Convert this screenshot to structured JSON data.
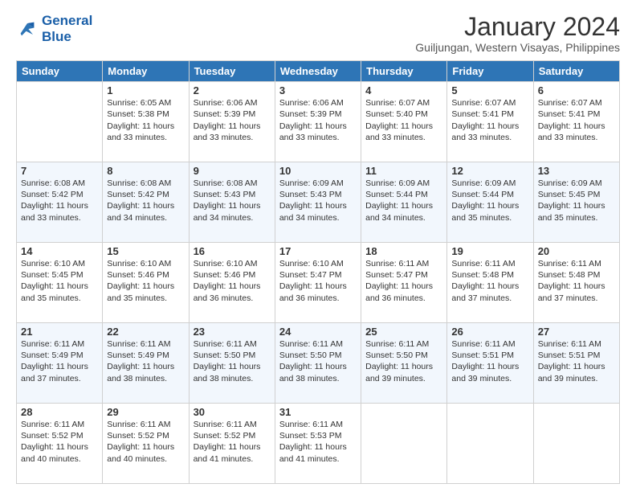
{
  "logo": {
    "line1": "General",
    "line2": "Blue"
  },
  "title": "January 2024",
  "location": "Guiljungan, Western Visayas, Philippines",
  "days": [
    "Sunday",
    "Monday",
    "Tuesday",
    "Wednesday",
    "Thursday",
    "Friday",
    "Saturday"
  ],
  "weeks": [
    [
      {
        "num": "",
        "empty": true
      },
      {
        "num": "1",
        "sunrise": "Sunrise: 6:05 AM",
        "sunset": "Sunset: 5:38 PM",
        "daylight": "Daylight: 11 hours and 33 minutes."
      },
      {
        "num": "2",
        "sunrise": "Sunrise: 6:06 AM",
        "sunset": "Sunset: 5:39 PM",
        "daylight": "Daylight: 11 hours and 33 minutes."
      },
      {
        "num": "3",
        "sunrise": "Sunrise: 6:06 AM",
        "sunset": "Sunset: 5:39 PM",
        "daylight": "Daylight: 11 hours and 33 minutes."
      },
      {
        "num": "4",
        "sunrise": "Sunrise: 6:07 AM",
        "sunset": "Sunset: 5:40 PM",
        "daylight": "Daylight: 11 hours and 33 minutes."
      },
      {
        "num": "5",
        "sunrise": "Sunrise: 6:07 AM",
        "sunset": "Sunset: 5:41 PM",
        "daylight": "Daylight: 11 hours and 33 minutes."
      },
      {
        "num": "6",
        "sunrise": "Sunrise: 6:07 AM",
        "sunset": "Sunset: 5:41 PM",
        "daylight": "Daylight: 11 hours and 33 minutes."
      }
    ],
    [
      {
        "num": "7",
        "sunrise": "Sunrise: 6:08 AM",
        "sunset": "Sunset: 5:42 PM",
        "daylight": "Daylight: 11 hours and 33 minutes."
      },
      {
        "num": "8",
        "sunrise": "Sunrise: 6:08 AM",
        "sunset": "Sunset: 5:42 PM",
        "daylight": "Daylight: 11 hours and 34 minutes."
      },
      {
        "num": "9",
        "sunrise": "Sunrise: 6:08 AM",
        "sunset": "Sunset: 5:43 PM",
        "daylight": "Daylight: 11 hours and 34 minutes."
      },
      {
        "num": "10",
        "sunrise": "Sunrise: 6:09 AM",
        "sunset": "Sunset: 5:43 PM",
        "daylight": "Daylight: 11 hours and 34 minutes."
      },
      {
        "num": "11",
        "sunrise": "Sunrise: 6:09 AM",
        "sunset": "Sunset: 5:44 PM",
        "daylight": "Daylight: 11 hours and 34 minutes."
      },
      {
        "num": "12",
        "sunrise": "Sunrise: 6:09 AM",
        "sunset": "Sunset: 5:44 PM",
        "daylight": "Daylight: 11 hours and 35 minutes."
      },
      {
        "num": "13",
        "sunrise": "Sunrise: 6:09 AM",
        "sunset": "Sunset: 5:45 PM",
        "daylight": "Daylight: 11 hours and 35 minutes."
      }
    ],
    [
      {
        "num": "14",
        "sunrise": "Sunrise: 6:10 AM",
        "sunset": "Sunset: 5:45 PM",
        "daylight": "Daylight: 11 hours and 35 minutes."
      },
      {
        "num": "15",
        "sunrise": "Sunrise: 6:10 AM",
        "sunset": "Sunset: 5:46 PM",
        "daylight": "Daylight: 11 hours and 35 minutes."
      },
      {
        "num": "16",
        "sunrise": "Sunrise: 6:10 AM",
        "sunset": "Sunset: 5:46 PM",
        "daylight": "Daylight: 11 hours and 36 minutes."
      },
      {
        "num": "17",
        "sunrise": "Sunrise: 6:10 AM",
        "sunset": "Sunset: 5:47 PM",
        "daylight": "Daylight: 11 hours and 36 minutes."
      },
      {
        "num": "18",
        "sunrise": "Sunrise: 6:11 AM",
        "sunset": "Sunset: 5:47 PM",
        "daylight": "Daylight: 11 hours and 36 minutes."
      },
      {
        "num": "19",
        "sunrise": "Sunrise: 6:11 AM",
        "sunset": "Sunset: 5:48 PM",
        "daylight": "Daylight: 11 hours and 37 minutes."
      },
      {
        "num": "20",
        "sunrise": "Sunrise: 6:11 AM",
        "sunset": "Sunset: 5:48 PM",
        "daylight": "Daylight: 11 hours and 37 minutes."
      }
    ],
    [
      {
        "num": "21",
        "sunrise": "Sunrise: 6:11 AM",
        "sunset": "Sunset: 5:49 PM",
        "daylight": "Daylight: 11 hours and 37 minutes."
      },
      {
        "num": "22",
        "sunrise": "Sunrise: 6:11 AM",
        "sunset": "Sunset: 5:49 PM",
        "daylight": "Daylight: 11 hours and 38 minutes."
      },
      {
        "num": "23",
        "sunrise": "Sunrise: 6:11 AM",
        "sunset": "Sunset: 5:50 PM",
        "daylight": "Daylight: 11 hours and 38 minutes."
      },
      {
        "num": "24",
        "sunrise": "Sunrise: 6:11 AM",
        "sunset": "Sunset: 5:50 PM",
        "daylight": "Daylight: 11 hours and 38 minutes."
      },
      {
        "num": "25",
        "sunrise": "Sunrise: 6:11 AM",
        "sunset": "Sunset: 5:50 PM",
        "daylight": "Daylight: 11 hours and 39 minutes."
      },
      {
        "num": "26",
        "sunrise": "Sunrise: 6:11 AM",
        "sunset": "Sunset: 5:51 PM",
        "daylight": "Daylight: 11 hours and 39 minutes."
      },
      {
        "num": "27",
        "sunrise": "Sunrise: 6:11 AM",
        "sunset": "Sunset: 5:51 PM",
        "daylight": "Daylight: 11 hours and 39 minutes."
      }
    ],
    [
      {
        "num": "28",
        "sunrise": "Sunrise: 6:11 AM",
        "sunset": "Sunset: 5:52 PM",
        "daylight": "Daylight: 11 hours and 40 minutes."
      },
      {
        "num": "29",
        "sunrise": "Sunrise: 6:11 AM",
        "sunset": "Sunset: 5:52 PM",
        "daylight": "Daylight: 11 hours and 40 minutes."
      },
      {
        "num": "30",
        "sunrise": "Sunrise: 6:11 AM",
        "sunset": "Sunset: 5:52 PM",
        "daylight": "Daylight: 11 hours and 41 minutes."
      },
      {
        "num": "31",
        "sunrise": "Sunrise: 6:11 AM",
        "sunset": "Sunset: 5:53 PM",
        "daylight": "Daylight: 11 hours and 41 minutes."
      },
      {
        "num": "",
        "empty": true
      },
      {
        "num": "",
        "empty": true
      },
      {
        "num": "",
        "empty": true
      }
    ]
  ]
}
